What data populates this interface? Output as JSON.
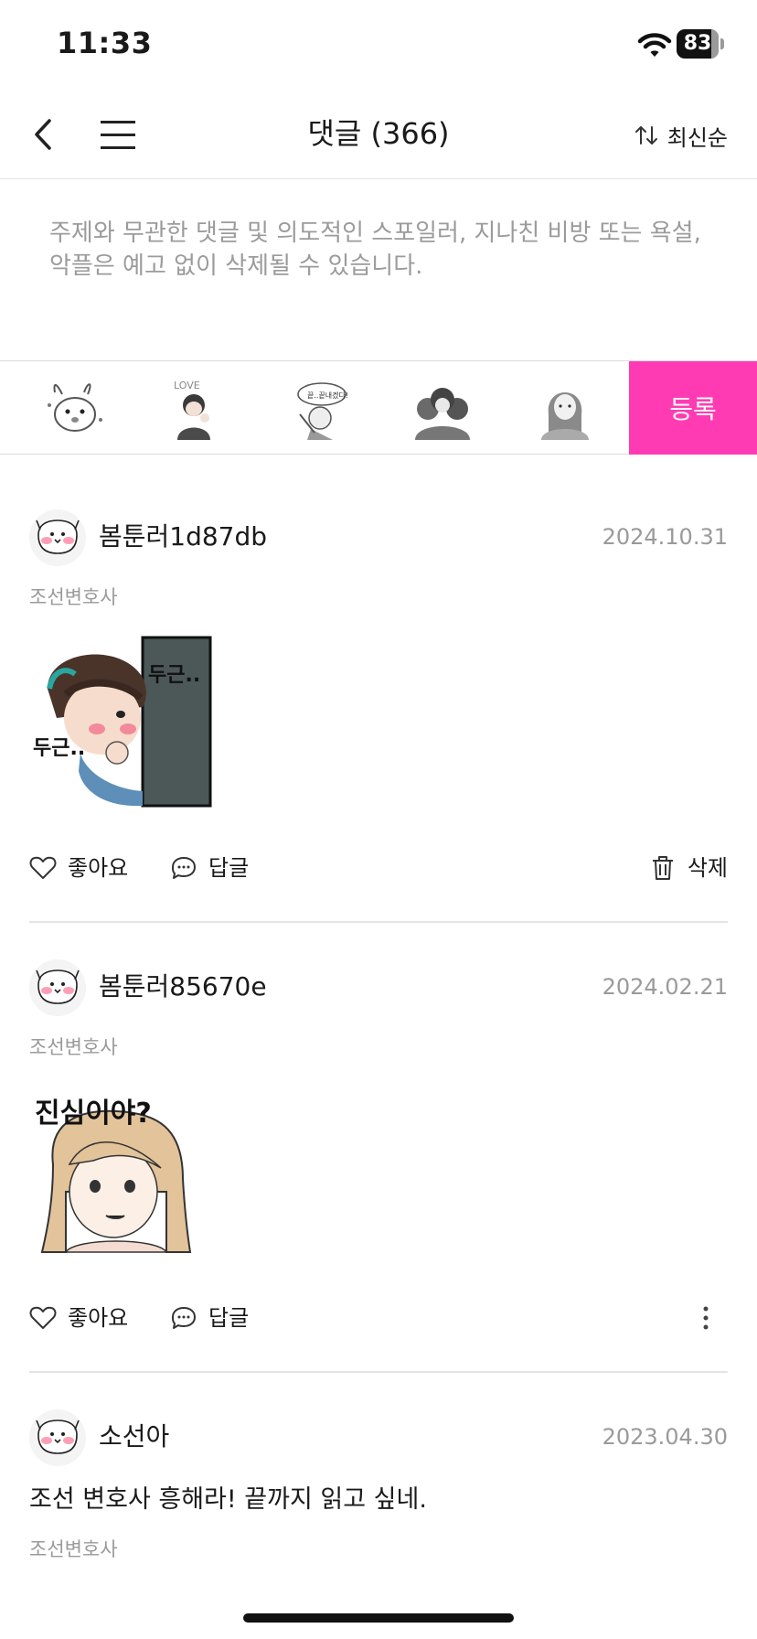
{
  "status_bar": {
    "time": "11:33",
    "battery_percent": "83"
  },
  "header": {
    "title": "댓글 (366)",
    "sort_label": "최신순"
  },
  "comment_input": {
    "placeholder": "주제와 무관한 댓글 및 의도적인 스포일러, 지나친 비방 또는 욕설, 악플은 예고 없이 삭제될 수 있습니다."
  },
  "sticker_bar": {
    "stickers": [
      "bunny-sticker",
      "love-sticker",
      "speech-bubble-sticker",
      "group-sticker",
      "girl-sticker"
    ],
    "register_label": "등록",
    "accent": "#ff3bb4"
  },
  "comments": [
    {
      "username": "봄툰러1d87db",
      "date": "2024.10.31",
      "series": "조선변호사",
      "sticker_text": [
        "두근..",
        "두근.."
      ],
      "like_label": "좋아요",
      "reply_label": "답글",
      "delete_label": "삭제"
    },
    {
      "username": "봄툰러85670e",
      "date": "2024.02.21",
      "series": "조선변호사",
      "sticker_text": [
        "진심이야?"
      ],
      "like_label": "좋아요",
      "reply_label": "답글"
    },
    {
      "username": "소선아",
      "date": "2023.04.30",
      "text": "조선 변호사 흥해라! 끝까지 읽고 싶네.",
      "series": "조선변호사"
    }
  ]
}
